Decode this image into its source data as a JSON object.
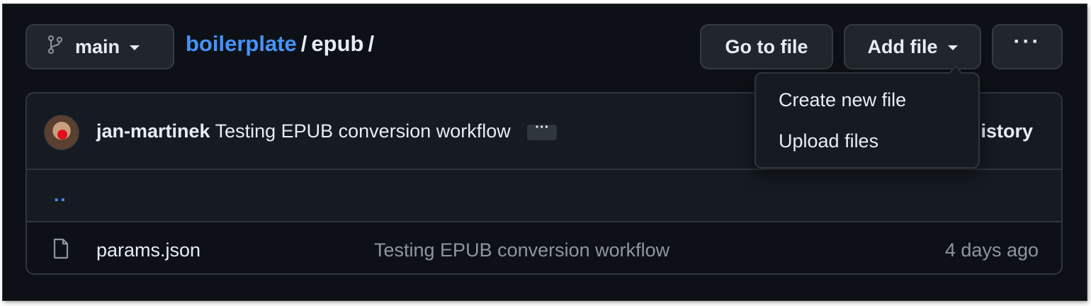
{
  "branch": {
    "label": "main",
    "icon": "git-branch-icon"
  },
  "breadcrumb": {
    "repo": "boilerplate",
    "separator": "/",
    "folder": "epub",
    "trailing": "/"
  },
  "toolbar": {
    "goto_label": "Go to file",
    "addfile_label": "Add file",
    "more_label": "···"
  },
  "add_file_menu": {
    "items": [
      {
        "label": "Create new file"
      },
      {
        "label": "Upload files"
      }
    ]
  },
  "latest_commit": {
    "author": "jan-martinek",
    "message": "Testing EPUB conversion workflow",
    "ellipsis": "···",
    "history_label": "istory"
  },
  "parent_dir": {
    "label": ".."
  },
  "files": [
    {
      "name": "params.json",
      "commit_message": "Testing EPUB conversion workflow",
      "age": "4 days ago",
      "icon": "file-icon"
    }
  ],
  "colors": {
    "link": "#4493f8",
    "background": "#0d1117",
    "panel": "#161b22",
    "border": "#30363d",
    "muted": "#8d96a0"
  }
}
